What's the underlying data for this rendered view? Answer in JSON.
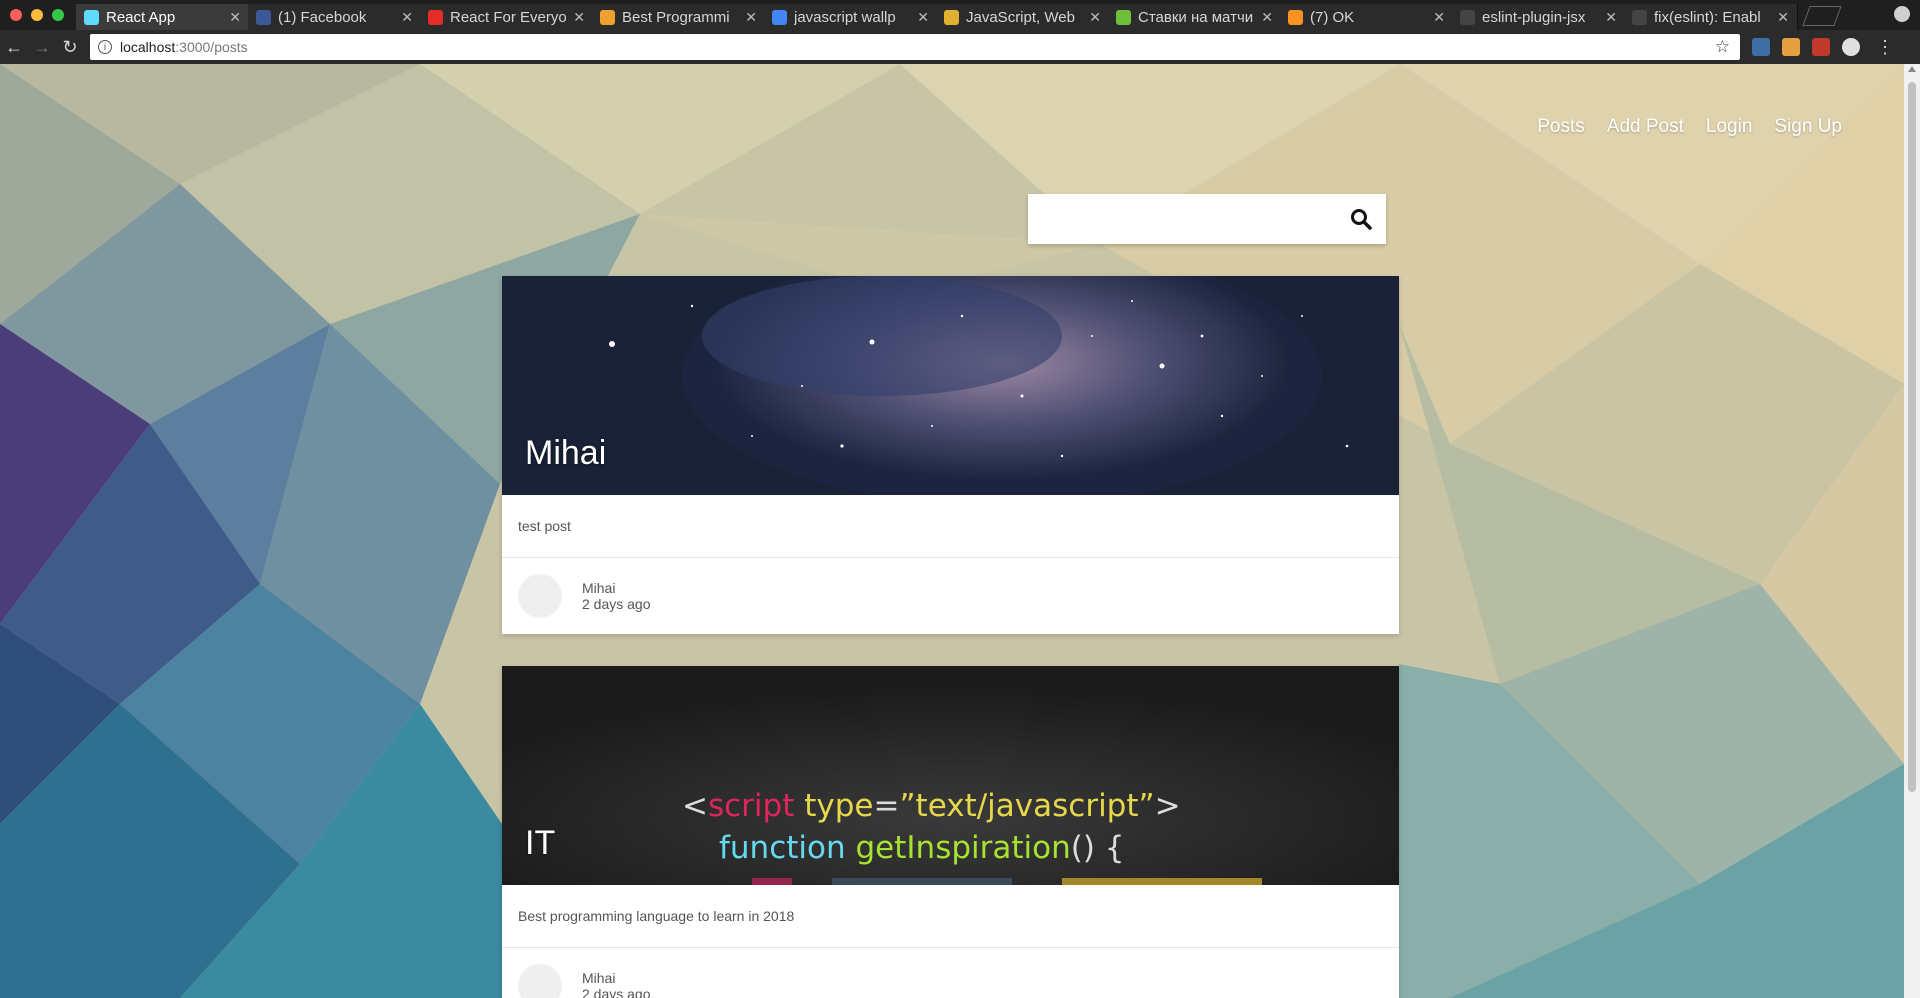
{
  "browser": {
    "tabs": [
      {
        "label": "React App",
        "active": true,
        "icon": "react-icon",
        "color": "#61dafb"
      },
      {
        "label": "(1) Facebook",
        "active": false,
        "icon": "facebook-icon",
        "color": "#3b5998"
      },
      {
        "label": "React For Everyo",
        "active": false,
        "icon": "youtube-icon",
        "color": "#e52d27"
      },
      {
        "label": "Best Programmi",
        "active": false,
        "icon": "sp-icon",
        "color": "#f0a030"
      },
      {
        "label": "javascript wallp",
        "active": false,
        "icon": "google-icon",
        "color": "#4285f4"
      },
      {
        "label": "JavaScript, Web",
        "active": false,
        "icon": "w-icon",
        "color": "#e0b030"
      },
      {
        "label": "Ставки на матчи",
        "active": false,
        "icon": "ball-icon",
        "color": "#6fbf3a"
      },
      {
        "label": "(7) OK",
        "active": false,
        "icon": "ok-icon",
        "color": "#f7931e"
      },
      {
        "label": "eslint-plugin-jsx",
        "active": false,
        "icon": "github-icon",
        "color": "#444444"
      },
      {
        "label": "fix(eslint): Enabl",
        "active": false,
        "icon": "github-icon",
        "color": "#444444"
      }
    ],
    "url_host": "localhost",
    "url_path": ":3000/posts"
  },
  "nav": {
    "posts": "Posts",
    "add_post": "Add Post",
    "login": "Login",
    "sign_up": "Sign Up"
  },
  "search": {
    "placeholder": "",
    "value": ""
  },
  "posts": [
    {
      "title": "Mihai",
      "text": "test post",
      "author": "Mihai",
      "time": "2 days ago"
    },
    {
      "title": "IT",
      "text": "Best programming language to learn in 2018",
      "author": "Mihai",
      "time": "2 days ago",
      "code_line1_tag": "script",
      "code_line1_attr": "type",
      "code_line1_value": "”text/javascript”",
      "code_line2_kw": "function",
      "code_line2_fn": "getInspiration",
      "code_line2_rest": "() {"
    }
  ],
  "colors": {
    "accent_white": "#ffffff",
    "code_tag": "#e0245e",
    "code_attr": "#e6d74b",
    "code_kw": "#66d9ef",
    "code_fn": "#a6e22e"
  }
}
